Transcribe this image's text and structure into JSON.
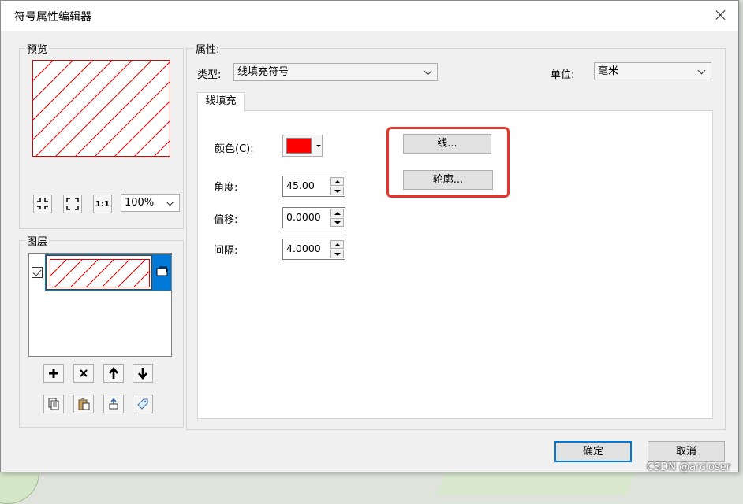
{
  "dialog": {
    "title": "符号属性编辑器",
    "ok_label": "确定",
    "cancel_label": "取消"
  },
  "preview": {
    "group_label": "预览",
    "zoom_value": "100%"
  },
  "layers": {
    "group_label": "图层"
  },
  "properties": {
    "group_label": "属性:",
    "type_label": "类型:",
    "type_value": "线填充符号",
    "unit_label": "单位:",
    "unit_value": "毫米",
    "tab_label": "线填充",
    "color_label": "颜色(C):",
    "color_value": "#ff0000",
    "angle_label": "角度:",
    "angle_value": "45.00",
    "offset_label": "偏移:",
    "offset_value": "0.0000",
    "spacing_label": "间隔:",
    "spacing_value": "4.0000",
    "line_button_label": "线...",
    "outline_button_label": "轮廓..."
  },
  "watermark": "CSDN @arcloser",
  "colors": {
    "accent": "#0078d7",
    "hatch": "#e00000",
    "highlight": "#e8322b"
  }
}
